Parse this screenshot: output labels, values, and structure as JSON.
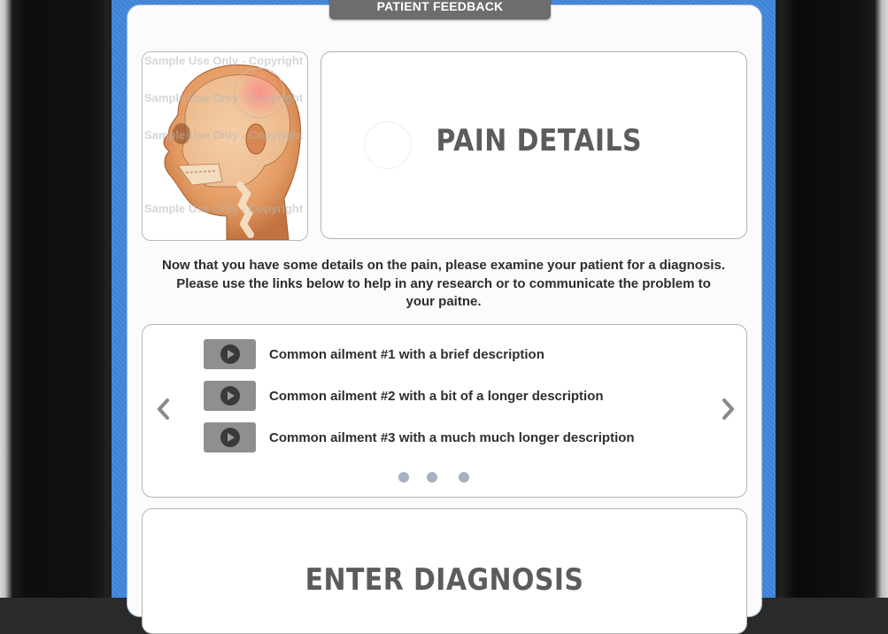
{
  "header": {
    "title": "PATIENT FEEDBACK"
  },
  "image_card": {
    "watermark_lines": [
      "Sample Use Only - Copyright",
      "Sample Use Only - Copyright",
      "Sample Use Only - Copyright",
      "Sample Use Only - Copyright"
    ]
  },
  "pain_card": {
    "title": "PAIN DETAILS"
  },
  "instructions": {
    "line1": "Now that you have some details on the pain, please examine your patient for a diagnosis.",
    "line2": "Please use the links below to help in any research or to communicate the problem to",
    "line3": "your paitne."
  },
  "ailments": [
    {
      "label": "Common ailment #1 with a brief description"
    },
    {
      "label": "Common ailment #2 with a bit of a longer description"
    },
    {
      "label": "Common ailment #3 with a much much  longer description"
    }
  ],
  "pager": {
    "pages": 3
  },
  "diagnosis": {
    "title": "ENTER DIAGNOSIS"
  },
  "colors": {
    "accent_blue": "#3f86db",
    "header_tab": "#6d6d6d",
    "pager_dot": "#a6b2c2"
  },
  "icons": {
    "nav_prev": "chevron-left-icon",
    "nav_next": "chevron-right-icon",
    "play": "play-icon"
  }
}
